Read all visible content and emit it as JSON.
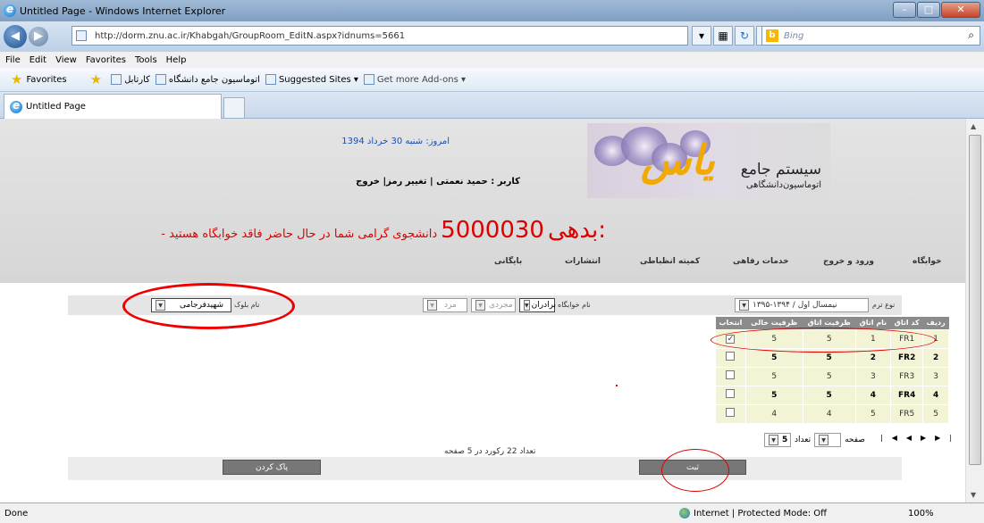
{
  "window": {
    "title": "Untitled Page - Windows Internet Explorer",
    "min": "–",
    "max": "□",
    "close": "✕"
  },
  "address": {
    "url": "http://dorm.znu.ac.ir/Khabgah/GroupRoom_EditN.aspx?idnums=5661",
    "search_placeholder": "Bing"
  },
  "menu": [
    "File",
    "Edit",
    "View",
    "Favorites",
    "Tools",
    "Help"
  ],
  "favorites": {
    "label": "Favorites",
    "items": [
      "کارتابل",
      "اتوماسیون جامع دانشگاه",
      "Suggested Sites ▾",
      "Get more Add-ons ▾"
    ]
  },
  "tab": {
    "label": "Untitled Page"
  },
  "header": {
    "logo_line1": "سیستم جامع",
    "logo_line2": "اتوماسیون‌دانشگاهی",
    "logo_mark": "یاس",
    "today": "امروز: شنبه 30 خرداد 1394",
    "user": "کاربر : حمید نعمتی | تغییر رمز| خروج"
  },
  "debt": {
    "label": "بدهی:",
    "amount": "5000030",
    "message": "- دانشجوی گرامی شما در حال حاضر فاقد خوابگاه هستید"
  },
  "nav": [
    "خوابگاه",
    "ورود و خروج",
    "خدمات رفاهی",
    "کمیته انظباطی",
    "انتشارات",
    "بایگانی"
  ],
  "filters": {
    "term_label": "نوع ترم",
    "term_value": "نیمسال اول / ۱۳۹۴-۱۳۹۵",
    "dorm_label": "نام خوابگاه",
    "dorm_value": "برادران",
    "single_value": "مجردی",
    "gender_value": "مرد",
    "block_label": "نام بلوک",
    "block_value": "شهیدفرجامی"
  },
  "grid": {
    "headers": [
      "ردیف",
      "کد اتاق",
      "نام اتاق",
      "ظرفیت اتاق",
      "ظرفیت خالی",
      "انتخاب"
    ],
    "rows": [
      {
        "row": "1",
        "code": "FR1",
        "name": "1",
        "capacity": "5",
        "free": "5",
        "checked": true,
        "bold": false
      },
      {
        "row": "2",
        "code": "FR2",
        "name": "2",
        "capacity": "5",
        "free": "5",
        "checked": false,
        "bold": true
      },
      {
        "row": "3",
        "code": "FR3",
        "name": "3",
        "capacity": "5",
        "free": "5",
        "checked": false,
        "bold": false
      },
      {
        "row": "4",
        "code": "FR4",
        "name": "4",
        "capacity": "5",
        "free": "5",
        "checked": false,
        "bold": true
      },
      {
        "row": "5",
        "code": "FR5",
        "name": "5",
        "capacity": "4",
        "free": "4",
        "checked": false,
        "bold": false
      }
    ]
  },
  "pager": {
    "page_label": "صفحه",
    "count_label": "تعداد",
    "count_value": "5",
    "summary": "تعداد 22 رکورد در 5 صفحه"
  },
  "actions": {
    "submit": "ثبت",
    "clear": "پاک کردن"
  },
  "status": {
    "left": "Done",
    "zone": "Internet | Protected Mode: Off",
    "zoom": "100%"
  }
}
